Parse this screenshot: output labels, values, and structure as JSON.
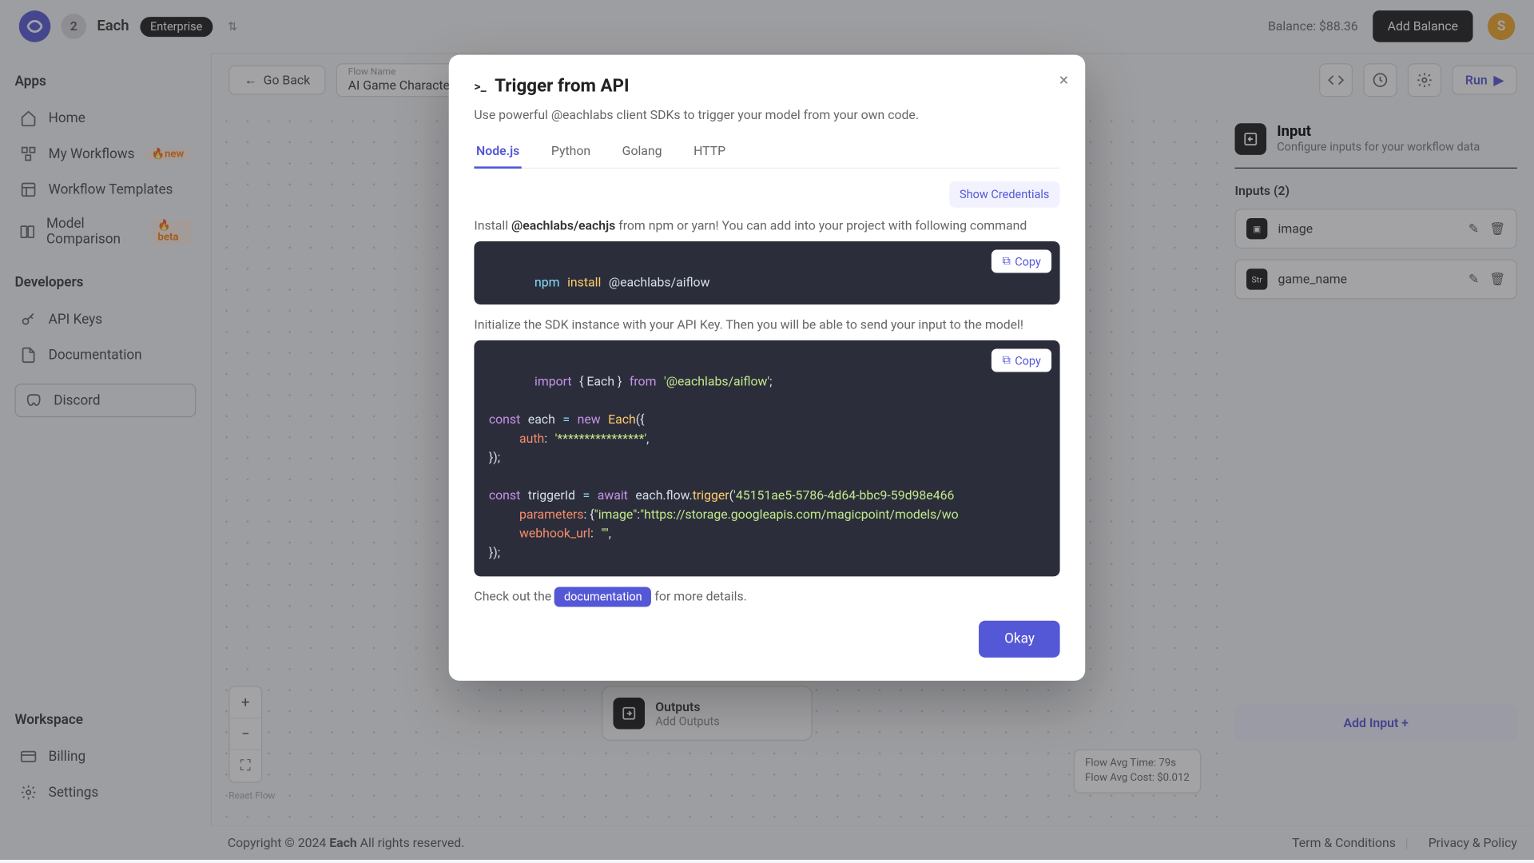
{
  "header": {
    "team_initial": "2",
    "org_name": "Each",
    "plan": "Enterprise",
    "balance_label": "Balance: $88.36",
    "add_balance": "Add Balance",
    "avatar_initial": "S"
  },
  "sidebar": {
    "apps_label": "Apps",
    "items_apps": [
      {
        "label": "Home",
        "icon": "home"
      },
      {
        "label": "My Workflows",
        "icon": "workflows",
        "badge": "new"
      },
      {
        "label": "Workflow Templates",
        "icon": "templates"
      },
      {
        "label": "Model Comparison",
        "icon": "compare",
        "badge": "beta"
      }
    ],
    "devs_label": "Developers",
    "items_devs": [
      {
        "label": "API Keys",
        "icon": "key"
      },
      {
        "label": "Documentation",
        "icon": "doc"
      }
    ],
    "discord_label": "Discord",
    "workspace_label": "Workspace",
    "items_workspace": [
      {
        "label": "Billing",
        "icon": "billing"
      },
      {
        "label": "Settings",
        "icon": "settings"
      }
    ]
  },
  "toolbar": {
    "go_back": "Go Back",
    "flow_name_label": "Flow Name",
    "flow_name": "AI Game Character Gen",
    "run": "Run"
  },
  "canvas": {
    "outputs_title": "Outputs",
    "outputs_sub": "Add Outputs",
    "stats_time": "Flow Avg Time: 79s",
    "stats_cost": "Flow Avg Cost: $0.012",
    "react_flow": "React Flow"
  },
  "inspector": {
    "title": "Input",
    "sub": "Configure inputs for your workflow data",
    "inputs_label": "Inputs (2)",
    "rows": [
      {
        "name": "image",
        "icon_text": "▣"
      },
      {
        "name": "game_name",
        "icon_text": "Str"
      }
    ],
    "add_input": "Add Input +"
  },
  "footer": {
    "copyright_prefix": "Copyright © 2024 ",
    "copyright_brand": "Each",
    "copyright_suffix": " All rights reserved.",
    "terms": "Term & Conditions",
    "privacy": "Privacy & Policy"
  },
  "modal": {
    "title": "Trigger from API",
    "desc": "Use powerful @eachlabs client SDKs to trigger your model from your own code.",
    "tabs": [
      "Node.js",
      "Python",
      "Golang",
      "HTTP"
    ],
    "active_tab": 0,
    "show_credentials": "Show Credentials",
    "install_prefix": "Install ",
    "install_pkg": "@eachlabs/eachjs",
    "install_suffix": " from npm or yarn! You can add into your project with following command",
    "init_text": "Initialize the SDK instance with your API Key. Then you will be able to send your input to the model!",
    "copy": "Copy",
    "doc_prefix": "Check out the ",
    "doc_chip": "documentation",
    "doc_suffix": " for more details.",
    "okay": "Okay",
    "install_cmd_parts": {
      "pm": "npm",
      "verb": "install",
      "pkg": "@eachlabs/aiflow"
    },
    "code_id": "45151ae5-5786-4d64-bbc9-59d98e466"
  }
}
